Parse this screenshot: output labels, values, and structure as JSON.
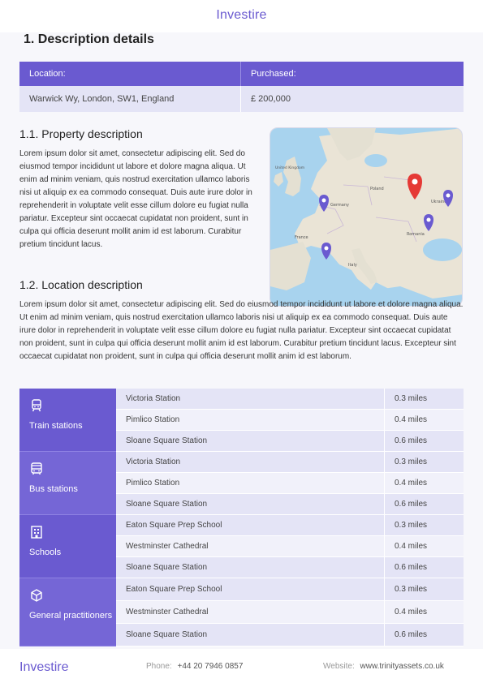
{
  "header": {
    "brand": "Investire"
  },
  "section": {
    "title": "1.  Description details"
  },
  "info": {
    "headers": [
      "Location:",
      "Purchased:"
    ],
    "values": [
      "Warwick Wy, London, SW1, England",
      "£ 200,000"
    ]
  },
  "property": {
    "title": "1.1. Property description",
    "text": "Lorem ipsum dolor sit amet, consectetur adipiscing elit. Sed do eiusmod tempor incididunt ut labore et dolore magna aliqua. Ut enim ad minim veniam, quis nostrud exercitation ullamco laboris nisi ut aliquip ex ea commodo consequat. Duis aute irure dolor in reprehenderit in voluptate velit esse cillum dolore eu fugiat nulla pariatur. Excepteur sint occaecat cupidatat non proident, sunt in culpa qui officia deserunt mollit anim id est laborum. Curabitur pretium tincidunt lacus."
  },
  "location": {
    "title": "1.2. Location description",
    "text": "Lorem ipsum dolor sit amet, consectetur adipiscing elit. Sed do eiusmod tempor incididunt ut labore et dolore magna aliqua. Ut enim ad minim veniam, quis nostrud exercitation ullamco laboris nisi ut aliquip ex ea commodo consequat. Duis aute irure dolor in reprehenderit in voluptate velit esse cillum dolore eu fugiat nulla pariatur. Excepteur sint occaecat cupidatat non proident, sunt in culpa qui officia deserunt mollit anim id est laborum. Curabitur pretium tincidunt lacus. Excepteur sint occaecat cupidatat non proident, sunt in culpa qui officia deserunt mollit anim id est laborum."
  },
  "map": {
    "labels": [
      "Poland",
      "Ukraine",
      "Germany",
      "France",
      "Romania",
      "Italy",
      "United Kingdom"
    ],
    "colors": {
      "main_pin": "#e53935",
      "pin": "#6a5ad0"
    }
  },
  "nearby": [
    {
      "category": "Train stations",
      "icon": "train-icon",
      "color": "#6a5ad0",
      "items": [
        {
          "name": "Victoria Station",
          "distance": "0.3 miles"
        },
        {
          "name": "Pimlico Station",
          "distance": "0.4 miles"
        },
        {
          "name": "Sloane Square Station",
          "distance": "0.6 miles"
        }
      ]
    },
    {
      "category": "Bus stations",
      "icon": "bus-icon",
      "color": "#7566d6",
      "items": [
        {
          "name": "Victoria Station",
          "distance": "0.3 miles"
        },
        {
          "name": "Pimlico Station",
          "distance": "0.4 miles"
        },
        {
          "name": "Sloane Square Station",
          "distance": "0.6 miles"
        }
      ]
    },
    {
      "category": "Schools",
      "icon": "school-icon",
      "color": "#6a5ad0",
      "items": [
        {
          "name": "Eaton Square Prep School",
          "distance": "0.3 miles"
        },
        {
          "name": "Westminster Cathedral",
          "distance": "0.4 miles"
        },
        {
          "name": "Sloane Square Station",
          "distance": "0.6 miles"
        }
      ]
    },
    {
      "category": "General practitioners",
      "icon": "cube-icon",
      "color": "#7566d6",
      "items": [
        {
          "name": "Eaton Square Prep School",
          "distance": "0.3 miles"
        },
        {
          "name": "Westminster Cathedral",
          "distance": "0.4 miles"
        },
        {
          "name": "Sloane Square Station",
          "distance": "0.6 miles"
        }
      ]
    }
  ],
  "footer": {
    "brand": "Investire",
    "phone_label": "Phone:",
    "phone": "+44 20 7946 0857",
    "web_label": "Website:",
    "web": "www.trinityassets.co.uk"
  }
}
